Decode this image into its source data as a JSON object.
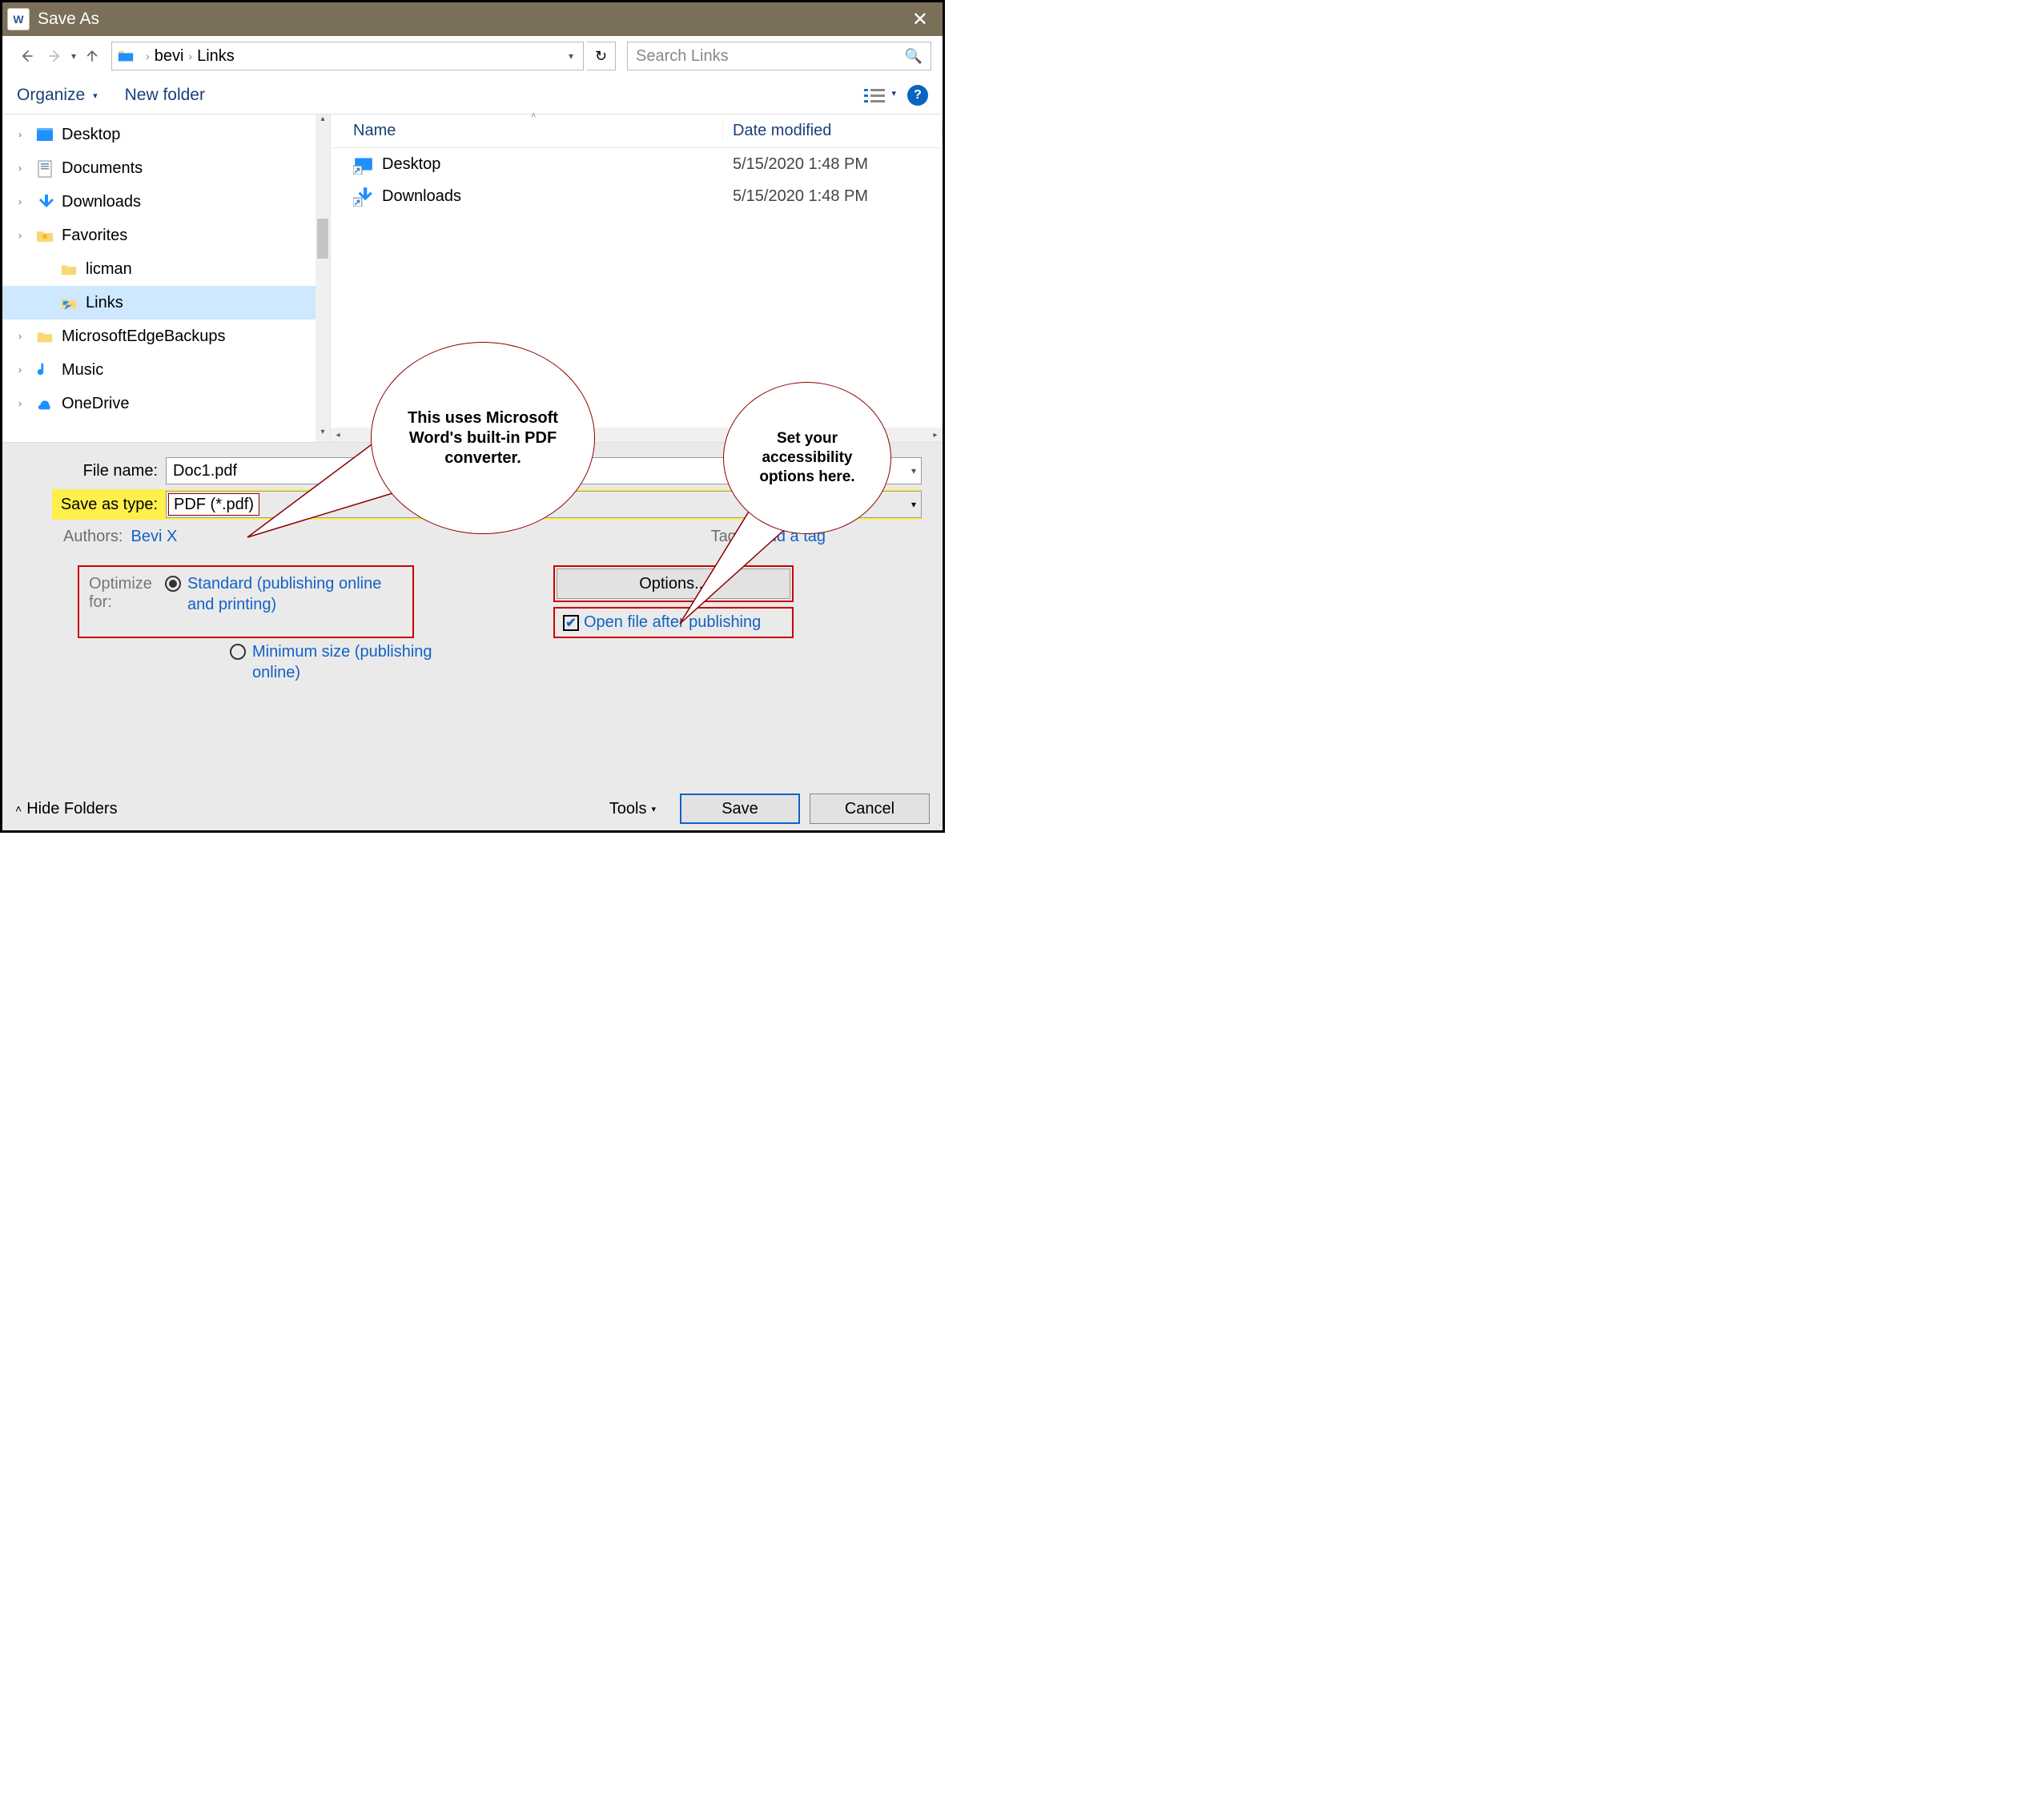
{
  "window": {
    "title": "Save As"
  },
  "breadcrumb": {
    "parts": [
      "bevi",
      "Links"
    ]
  },
  "search": {
    "placeholder": "Search Links"
  },
  "toolbar": {
    "organize": "Organize",
    "newfolder": "New folder"
  },
  "tree": {
    "items": [
      {
        "label": "Desktop",
        "expandable": true
      },
      {
        "label": "Documents",
        "expandable": true
      },
      {
        "label": "Downloads",
        "expandable": true
      },
      {
        "label": "Favorites",
        "expandable": true
      },
      {
        "label": "licman",
        "expandable": false,
        "indent": true
      },
      {
        "label": "Links",
        "expandable": false,
        "indent": true,
        "selected": true
      },
      {
        "label": "MicrosoftEdgeBackups",
        "expandable": true
      },
      {
        "label": "Music",
        "expandable": true
      },
      {
        "label": "OneDrive",
        "expandable": true
      }
    ]
  },
  "list": {
    "columns": {
      "name": "Name",
      "modified": "Date modified"
    },
    "rows": [
      {
        "name": "Desktop",
        "modified": "5/15/2020 1:48 PM"
      },
      {
        "name": "Downloads",
        "modified": "5/15/2020 1:48 PM"
      }
    ]
  },
  "form": {
    "filename_label": "File name:",
    "filename_value": "Doc1.pdf",
    "type_label": "Save as type:",
    "type_value": "PDF (*.pdf)",
    "authors_label": "Authors:",
    "authors_value": "Bevi X",
    "tags_label": "Tags:",
    "tags_value": "Add a tag",
    "optimize_label": "Optimize for:",
    "opt_standard": "Standard (publishing online and printing)",
    "opt_minimum": "Minimum size (publishing online)",
    "options_button": "Options...",
    "open_after": "Open file after publishing"
  },
  "footer": {
    "hide": "Hide Folders",
    "tools": "Tools",
    "save": "Save",
    "cancel": "Cancel"
  },
  "callouts": {
    "c1": "This uses Microsoft Word's built-in PDF converter.",
    "c2": "Set your accessibility options here."
  }
}
